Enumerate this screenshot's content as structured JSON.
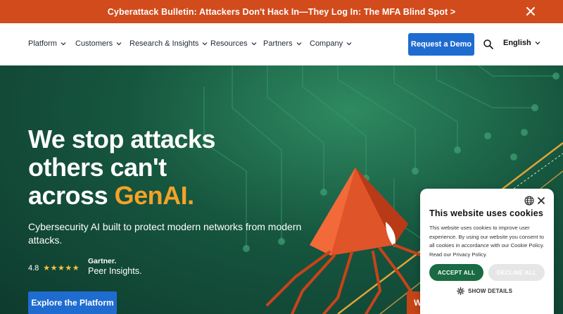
{
  "announcement": {
    "text": "Cyberattack Bulletin: Attackers Don't Hack In—They Log In: The MFA Blind Spot >"
  },
  "nav": {
    "items": [
      {
        "label": "Platform"
      },
      {
        "label": "Customers"
      },
      {
        "label": "Research & Insights"
      },
      {
        "label": "Resources"
      },
      {
        "label": "Partners"
      },
      {
        "label": "Company"
      }
    ],
    "demo_label": "Request a Demo",
    "language": "English"
  },
  "hero": {
    "headline_line1": "We stop attacks",
    "headline_line2": "others can't",
    "headline_line3_prefix": "across ",
    "headline_accent": "GenAI.",
    "subhead": "Cybersecurity AI built to protect modern networks from modern attacks.",
    "rating_value": "4.8",
    "stars": "★★★★★",
    "gartner_brand": "Gartner.",
    "gartner_product": "Peer Insights.",
    "explore_label": "Explore the Platform",
    "watch_label": "Watch Now"
  },
  "cookie": {
    "title": "This website uses cookies",
    "body": "This website uses cookies to improve user experience. By using our website you consent to all cookies in accordance with our Cookie Policy. Read our Privacy Policy.",
    "accept_label": "ACCEPT ALL",
    "decline_label": "DECLINE ALL",
    "details_label": "SHOW DETAILS"
  },
  "colors": {
    "announcement_bg": "#d24b1c",
    "primary_button": "#1f6cd0",
    "hero_green": "#16563f",
    "accent_orange": "#f4a227",
    "accept_green": "#1a6b43"
  }
}
